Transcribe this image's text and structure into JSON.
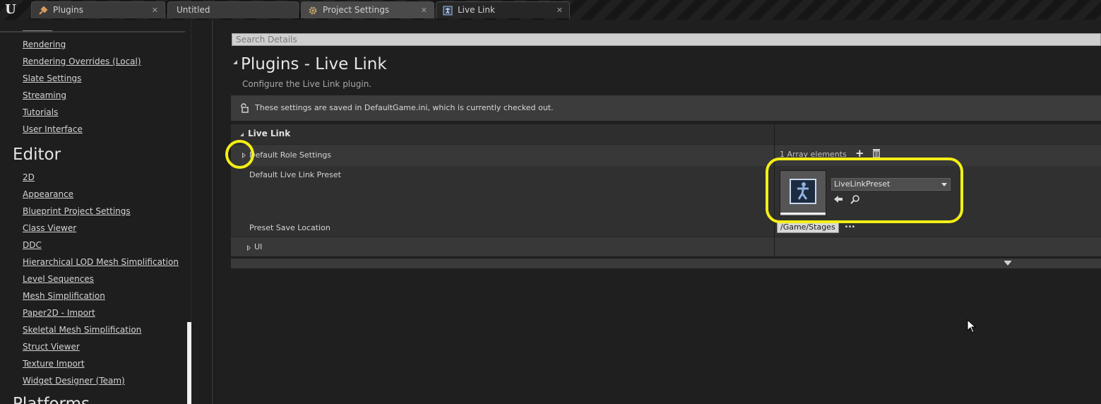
{
  "tabs": [
    {
      "label": "Plugins",
      "icon": "plug-icon"
    },
    {
      "label": "Untitled",
      "icon": ""
    },
    {
      "label": "Project Settings",
      "icon": "gear-icon"
    },
    {
      "label": "Live Link",
      "icon": "live-link-icon"
    }
  ],
  "sidebar": {
    "top_links": [
      "Rendering",
      "Rendering Overrides (Local)",
      "Slate Settings",
      "Streaming",
      "Tutorials",
      "User Interface"
    ],
    "editor_heading": "Editor",
    "editor_links": [
      "2D",
      "Appearance",
      "Blueprint Project Settings",
      "Class Viewer",
      "DDC",
      "Hierarchical LOD Mesh Simplification",
      "Level Sequences",
      "Mesh Simplification",
      "Paper2D - Import",
      "Skeletal Mesh Simplification",
      "Struct Viewer",
      "Texture Import",
      "Widget Designer (Team)"
    ],
    "platforms_heading": "Platforms"
  },
  "main": {
    "search_placeholder": "Search Details",
    "title": "Plugins - Live Link",
    "subtitle": "Configure the Live Link plugin.",
    "notice": "These settings are saved in DefaultGame.ini, which is currently checked out.",
    "category": "Live Link",
    "rows": {
      "role_settings_label": "Default Role Settings",
      "array_count": "1 Array elements",
      "preset_label": "Default Live Link Preset",
      "preset_value": "LiveLinkPreset",
      "save_location_label": "Preset Save Location",
      "save_location_value": "/Game/Stages",
      "browse_label": "...",
      "ui_label": "UI"
    }
  },
  "colors": {
    "highlight": "#f4ef15",
    "background": "#1a1a1a",
    "panel": "#272727"
  }
}
